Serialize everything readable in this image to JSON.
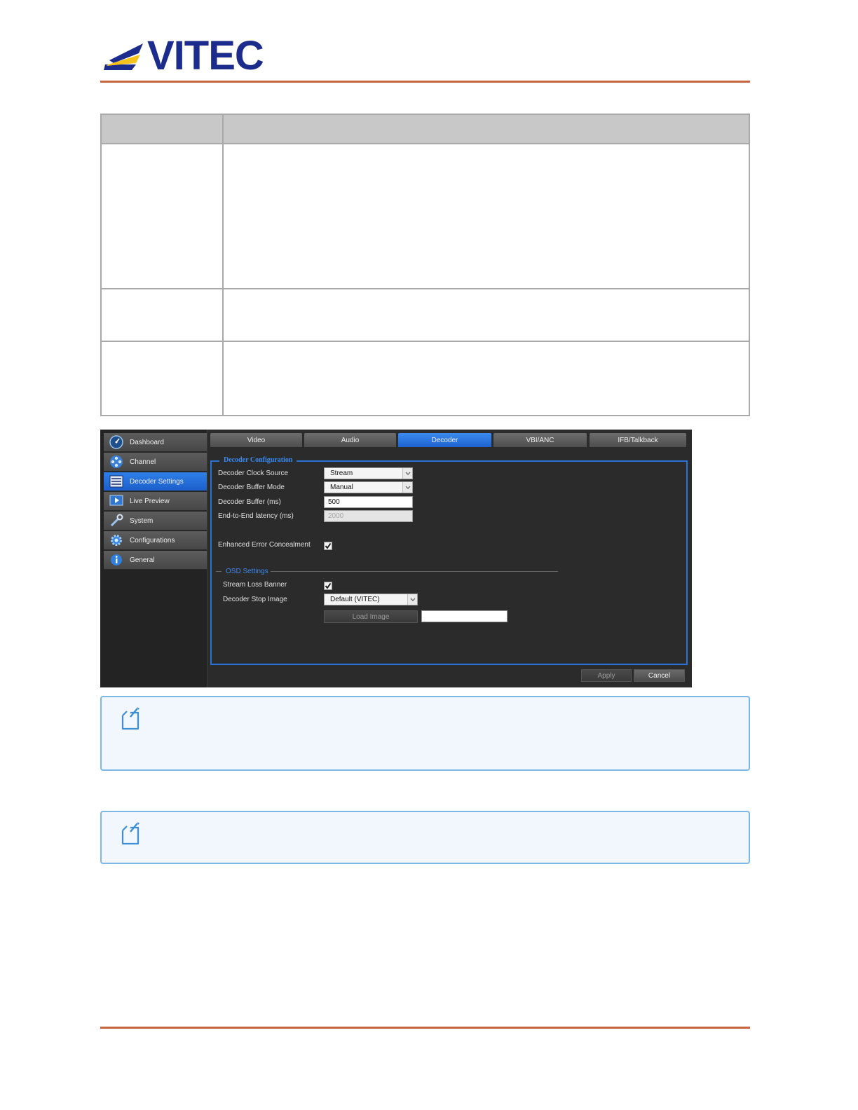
{
  "brand": {
    "logo_text": "VITEC",
    "colors": {
      "blue": "#1c2c8c",
      "yellow": "#f3c21b",
      "rule": "#c9633b"
    }
  },
  "decoder_ui": {
    "sidebar": {
      "items": [
        {
          "label": "Dashboard",
          "icon": "dashboard-gauge-icon"
        },
        {
          "label": "Channel",
          "icon": "channel-reel-icon"
        },
        {
          "label": "Decoder Settings",
          "icon": "decoder-settings-icon",
          "active": true
        },
        {
          "label": "Live Preview",
          "icon": "live-preview-icon"
        },
        {
          "label": "System",
          "icon": "wrench-icon"
        },
        {
          "label": "Configurations",
          "icon": "gear-icon"
        },
        {
          "label": "General",
          "icon": "info-icon"
        }
      ]
    },
    "tabs": [
      {
        "label": "Video"
      },
      {
        "label": "Audio"
      },
      {
        "label": "Decoder",
        "active": true
      },
      {
        "label": "VBI/ANC"
      },
      {
        "label": "IFB/Talkback"
      }
    ],
    "decoder_config": {
      "legend": "Decoder Configuration",
      "clock_source": {
        "label": "Decoder Clock Source",
        "value": "Stream"
      },
      "buffer_mode": {
        "label": "Decoder Buffer Mode",
        "value": "Manual"
      },
      "buffer_ms": {
        "label": "Decoder Buffer (ms)",
        "value": "500"
      },
      "latency_ms": {
        "label": "End-to-End latency (ms)",
        "value": "2000"
      },
      "error_concealment": {
        "label": "Enhanced Error Concealment",
        "checked": true
      }
    },
    "osd": {
      "legend": "OSD Settings",
      "stream_loss_banner": {
        "label": "Stream Loss Banner",
        "checked": true
      },
      "stop_image": {
        "label": "Decoder Stop Image",
        "value": "Default (VITEC)"
      },
      "load_image_button": "Load Image",
      "image_path": ""
    },
    "actions": {
      "apply": "Apply",
      "cancel": "Cancel"
    }
  }
}
